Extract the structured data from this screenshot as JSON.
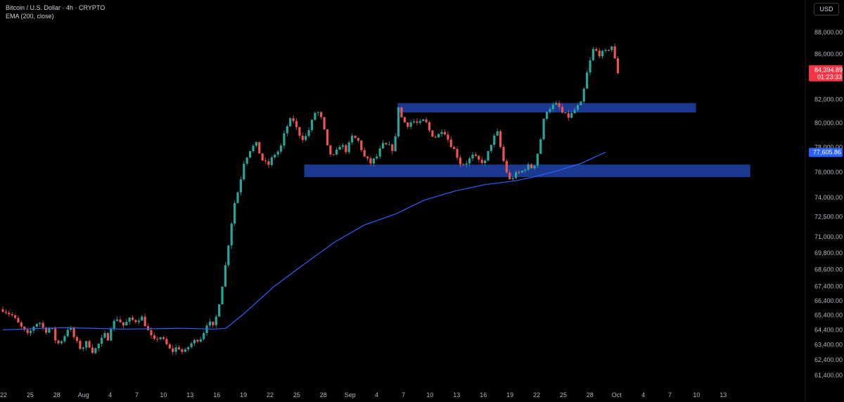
{
  "header": {
    "symbol_line": "Bitcoin / U.S. Dollar · 4h · CRYPTO",
    "indicator_line": "EMA (200, close)"
  },
  "currency_button": "USD",
  "colors": {
    "background": "#000000",
    "up": "#26a69a",
    "down": "#ef5350",
    "ema": "#2962ff",
    "zone": "#1e3fa0",
    "price_badge": "#f23645",
    "ema_badge": "#2962ff",
    "axis_text": "#b2b5be"
  },
  "chart_data": {
    "type": "candlestick",
    "timeframe": "4h",
    "x_tick_labels": [
      "22",
      "25",
      "28",
      "Aug",
      "4",
      "7",
      "10",
      "13",
      "16",
      "19",
      "22",
      "25",
      "28",
      "Sep",
      "4",
      "7",
      "10",
      "13",
      "16",
      "19",
      "22",
      "25",
      "28",
      "Oct",
      "4",
      "7",
      "10",
      "13"
    ],
    "y_tick_labels": [
      "88,000.00",
      "86,000.00",
      "82,000.00",
      "80,000.00",
      "78,000.00",
      "76,000.00",
      "74,000.00",
      "72,500.00",
      "71,000.00",
      "69,800.00",
      "68,600.00",
      "67,400.00",
      "66,400.00",
      "65,400.00",
      "64,400.00",
      "63,400.00",
      "62,400.00",
      "61,400.00"
    ],
    "y_scale": "log",
    "price_badge": {
      "value": "84,394.89",
      "countdown": "01:23:33"
    },
    "ema_badge": {
      "value": "77,605.86"
    },
    "ohlc_path": [
      [
        0,
        65800
      ],
      [
        1.5,
        65400
      ],
      [
        3,
        64600
      ],
      [
        4.2,
        64000
      ],
      [
        5,
        64600
      ],
      [
        6,
        65000
      ],
      [
        7,
        64300
      ],
      [
        8,
        64600
      ],
      [
        9,
        63400
      ],
      [
        10,
        63800
      ],
      [
        11,
        64700
      ],
      [
        12,
        63700
      ],
      [
        13,
        63100
      ],
      [
        14,
        63600
      ],
      [
        15,
        62900
      ],
      [
        16,
        63500
      ],
      [
        17,
        64100
      ],
      [
        17.5,
        63800
      ],
      [
        18,
        64700
      ],
      [
        19,
        65200
      ],
      [
        20,
        64700
      ],
      [
        21,
        65100
      ],
      [
        22,
        65000
      ],
      [
        23,
        65300
      ],
      [
        24,
        64400
      ],
      [
        25,
        63600
      ],
      [
        26,
        64000
      ],
      [
        27,
        63500
      ],
      [
        28,
        62900
      ],
      [
        29,
        63300
      ],
      [
        30,
        62800
      ],
      [
        31,
        63400
      ],
      [
        32,
        63700
      ],
      [
        33,
        63900
      ],
      [
        34,
        65000
      ],
      [
        35,
        64500
      ],
      [
        36,
        66500
      ],
      [
        36.8,
        68500
      ],
      [
        37.6,
        71000
      ],
      [
        38.4,
        73500
      ],
      [
        39.2,
        74800
      ],
      [
        40,
        76800
      ],
      [
        41,
        77800
      ],
      [
        42,
        78300
      ],
      [
        43,
        77000
      ],
      [
        44,
        76500
      ],
      [
        45,
        77400
      ],
      [
        46,
        77800
      ],
      [
        47,
        79600
      ],
      [
        48,
        80500
      ],
      [
        49,
        79200
      ],
      [
        50,
        78600
      ],
      [
        51,
        79700
      ],
      [
        52,
        81200
      ],
      [
        53,
        80200
      ],
      [
        54,
        77600
      ],
      [
        55,
        77200
      ],
      [
        56,
        78300
      ],
      [
        57,
        77700
      ],
      [
        58,
        78900
      ],
      [
        59,
        78500
      ],
      [
        60,
        77200
      ],
      [
        61,
        76700
      ],
      [
        62,
        77200
      ],
      [
        63,
        78200
      ],
      [
        64,
        78100
      ],
      [
        65,
        77700
      ],
      [
        65.5,
        81800
      ],
      [
        66,
        80600
      ],
      [
        67,
        79800
      ],
      [
        68,
        80200
      ],
      [
        69,
        79900
      ],
      [
        70,
        80300
      ],
      [
        71,
        79100
      ],
      [
        72,
        78800
      ],
      [
        73,
        79600
      ],
      [
        74,
        78500
      ],
      [
        75,
        77700
      ],
      [
        76,
        76600
      ],
      [
        77,
        76800
      ],
      [
        78,
        77300
      ],
      [
        79,
        76900
      ],
      [
        80,
        76800
      ],
      [
        81,
        78300
      ],
      [
        82,
        79300
      ],
      [
        83,
        77000
      ],
      [
        84,
        75300
      ],
      [
        85,
        75800
      ],
      [
        86,
        76000
      ],
      [
        87,
        76500
      ],
      [
        88,
        76300
      ],
      [
        89,
        78000
      ],
      [
        90,
        81000
      ],
      [
        91,
        81400
      ],
      [
        92,
        81600
      ],
      [
        93,
        80700
      ],
      [
        94,
        80500
      ],
      [
        95,
        81200
      ],
      [
        96,
        81700
      ],
      [
        97,
        84500
      ],
      [
        98,
        86500
      ],
      [
        99,
        86000
      ],
      [
        100,
        86200
      ],
      [
        101,
        86800
      ],
      [
        102,
        84400
      ]
    ],
    "ema_path": [
      [
        0,
        64400
      ],
      [
        10,
        64550
      ],
      [
        20,
        64450
      ],
      [
        30,
        64500
      ],
      [
        35,
        64450
      ],
      [
        37,
        64500
      ],
      [
        40,
        65500
      ],
      [
        45,
        67400
      ],
      [
        50,
        69000
      ],
      [
        55,
        70600
      ],
      [
        60,
        71900
      ],
      [
        65,
        72700
      ],
      [
        70,
        73800
      ],
      [
        75,
        74500
      ],
      [
        80,
        75000
      ],
      [
        85,
        75300
      ],
      [
        88,
        75600
      ],
      [
        92,
        76100
      ],
      [
        96,
        76700
      ],
      [
        100,
        77600
      ]
    ],
    "zones": [
      {
        "name": "upper",
        "from": 65.5,
        "to": 115,
        "low": 80900,
        "high": 81700
      },
      {
        "name": "lower",
        "from": 50,
        "to": 124,
        "low": 75600,
        "high": 76600
      }
    ]
  }
}
